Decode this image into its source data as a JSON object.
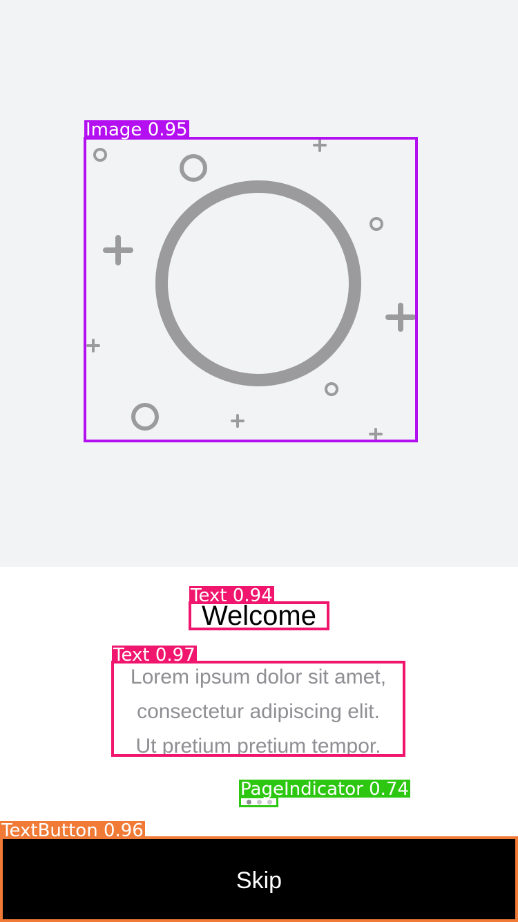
{
  "onboarding": {
    "title": "Welcome",
    "body_lines": [
      "Lorem ipsum dolor sit amet,",
      "consectetur adipiscing elit.",
      "Ut pretium pretium tempor."
    ],
    "illustration_icon": "circle-with-sparkles-icon",
    "page_indicator": {
      "count": 3,
      "active": 0
    },
    "skip_label": "Skip"
  },
  "detections": {
    "image": "Image 0.95",
    "title": "Text 0.94",
    "body": "Text 0.97",
    "pager": "PageIndicator 0.74",
    "button": "TextButton 0.96"
  },
  "colors": {
    "hero_background": "#f2f3f5",
    "illustration_gray": "#9b9b9d",
    "button_background": "#000000",
    "button_text": "#ffffff",
    "body_text": "#8e8e93",
    "det_image": "#b40ff0",
    "det_text": "#f0166e",
    "det_pager": "#2dc712",
    "det_button": "#f07a36"
  }
}
